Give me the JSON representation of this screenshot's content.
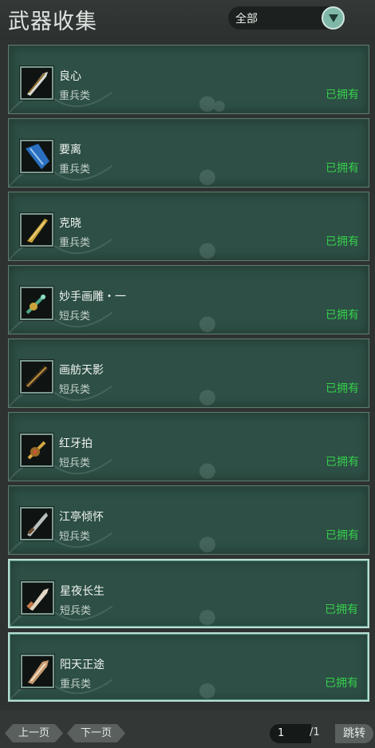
{
  "header": {
    "title": "武器收集",
    "filter_selected": "全部"
  },
  "weapons": [
    {
      "name": "良心",
      "category": "重兵类",
      "status": "已拥有",
      "icon": "heavy-blade-icon",
      "color": "#d8dcd4"
    },
    {
      "name": "要离",
      "category": "重兵类",
      "status": "已拥有",
      "icon": "blue-crystal-blade-icon",
      "color": "#2a6fc0"
    },
    {
      "name": "克晓",
      "category": "重兵类",
      "status": "已拥有",
      "icon": "golden-blade-icon",
      "color": "#c9a23a"
    },
    {
      "name": "妙手画雕・一",
      "category": "短兵类",
      "status": "已拥有",
      "icon": "jade-dagger-icon",
      "color": "#4fa98a"
    },
    {
      "name": "画舫天影",
      "category": "短兵类",
      "status": "已拥有",
      "icon": "ornate-dagger-icon",
      "color": "#b8913b"
    },
    {
      "name": "红牙拍",
      "category": "短兵类",
      "status": "已拥有",
      "icon": "golden-dagger-icon",
      "color": "#d6a844"
    },
    {
      "name": "江亭倾怀",
      "category": "短兵类",
      "status": "已拥有",
      "icon": "silver-dagger-icon",
      "color": "#b9c0c0"
    },
    {
      "name": "星夜长生",
      "category": "短兵类",
      "status": "已拥有",
      "icon": "bronze-dagger-icon",
      "color": "#c07a4a"
    },
    {
      "name": "阳天正途",
      "category": "重兵类",
      "status": "已拥有",
      "icon": "bronze-blade-icon",
      "color": "#c89a6e"
    }
  ],
  "footer": {
    "prev_label": "上一页",
    "next_label": "下一页",
    "page_current": "1",
    "page_total": "/1",
    "jump_label": "跳转"
  },
  "colors": {
    "background": "#2e3230",
    "card": "#2d4f45",
    "owned_green": "#35d04a",
    "filter_accent": "#7fb8a8"
  }
}
